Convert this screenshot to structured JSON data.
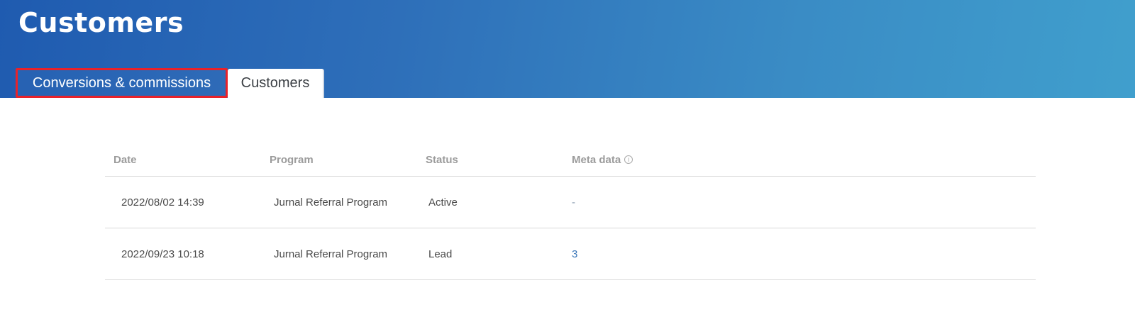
{
  "header": {
    "title": "Customers",
    "tabs": [
      {
        "label": "Conversions & commissions",
        "highlighted": true
      },
      {
        "label": "Customers",
        "active": true
      }
    ]
  },
  "table": {
    "columns": [
      "Date",
      "Program",
      "Status",
      "Meta data"
    ],
    "meta_info_icon": "info-icon",
    "rows": [
      {
        "date": "2022/08/02 14:39",
        "program": "Jurnal Referral Program",
        "status": "Active",
        "meta": "-"
      },
      {
        "date": "2022/09/23 10:18",
        "program": "Jurnal Referral Program",
        "status": "Lead",
        "meta": "3"
      }
    ]
  },
  "colors": {
    "header_start": "#1f5bb0",
    "header_end": "#409fcd",
    "highlight_border": "#e8222a",
    "link": "#3a76b8"
  }
}
